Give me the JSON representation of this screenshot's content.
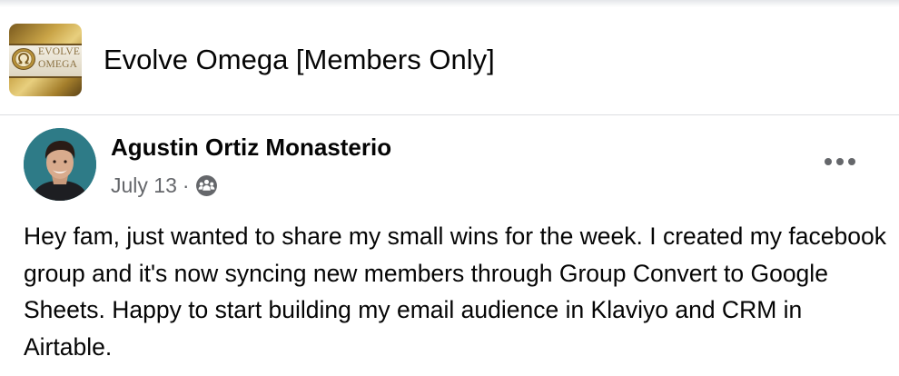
{
  "group": {
    "name": "Evolve Omega [Members Only]",
    "logo_line1": "EVOLVE",
    "logo_line2": "OMEGA",
    "logo_icon": "omega-seal-icon"
  },
  "post": {
    "author": "Agustin Ortiz Monasterio",
    "date": "July 13",
    "separator": "·",
    "audience_icon": "group-members-icon",
    "more_icon": "more-options-icon",
    "text": "Hey fam, just wanted to share my small wins for the week. I created my facebook group and it's now syncing new members through Group Convert to Google Sheets. Happy to start building my email audience in Klaviyo and CRM in Airtable."
  },
  "colors": {
    "text_primary": "#050505",
    "text_secondary": "#65676b",
    "avatar_bg": "#2e7b87",
    "logo_gold": "#c9a447"
  }
}
